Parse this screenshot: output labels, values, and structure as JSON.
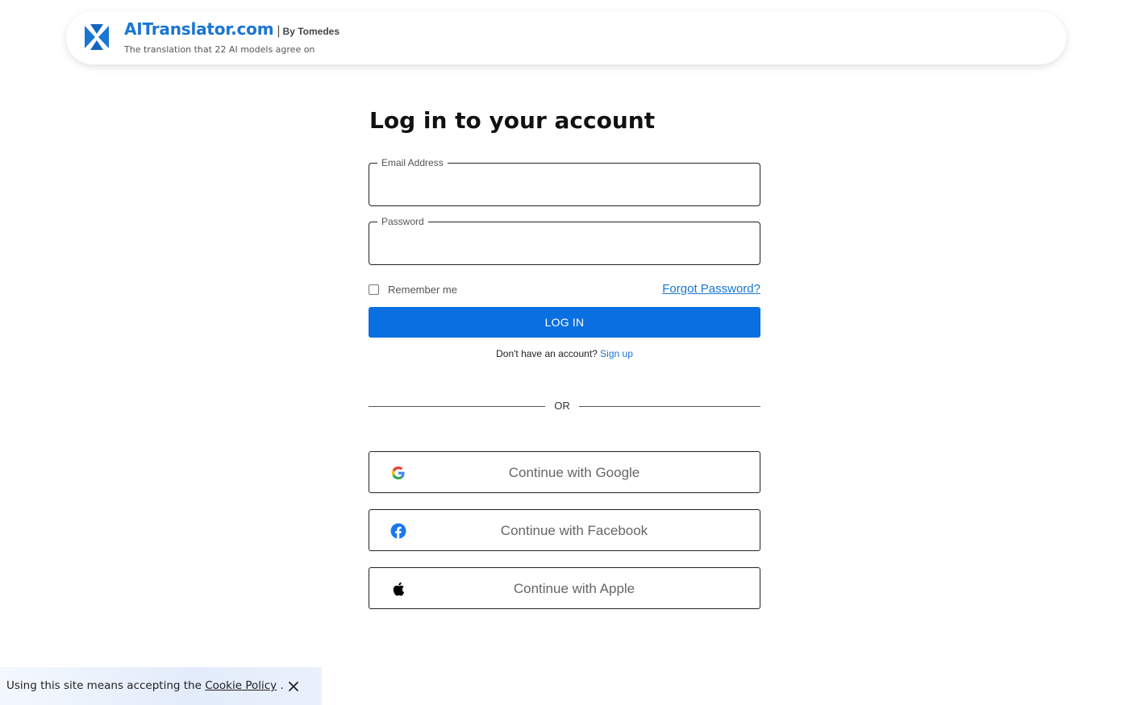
{
  "header": {
    "brand_name": "AITranslator.com",
    "brand_separator": "|",
    "brand_by": "By Tomedes",
    "tagline": "The translation that 22 AI models agree on",
    "logo_icon": "aitranslator-logo-icon",
    "brand_color": "#1976d2"
  },
  "form": {
    "title": "Log in to your account",
    "email_label": "Email Address",
    "email_value": "",
    "password_label": "Password",
    "password_value": "",
    "remember_label": "Remember me",
    "remember_checked": false,
    "forgot_label": "Forgot Password?",
    "login_label": "LOG IN",
    "login_color": "#0a6fe0",
    "no_account_text": "Don't have an account?",
    "signup_label": "Sign up",
    "or_text": "OR"
  },
  "social": {
    "google_label": "Continue with Google",
    "google_icon": "google-icon",
    "facebook_label": "Continue with Facebook",
    "facebook_icon": "facebook-icon",
    "apple_label": "Continue with Apple",
    "apple_icon": "apple-icon"
  },
  "cookie": {
    "text_before": "Using this site means accepting the ",
    "link_label": "Cookie Policy",
    "text_after": " .",
    "close_icon": "close-icon"
  }
}
